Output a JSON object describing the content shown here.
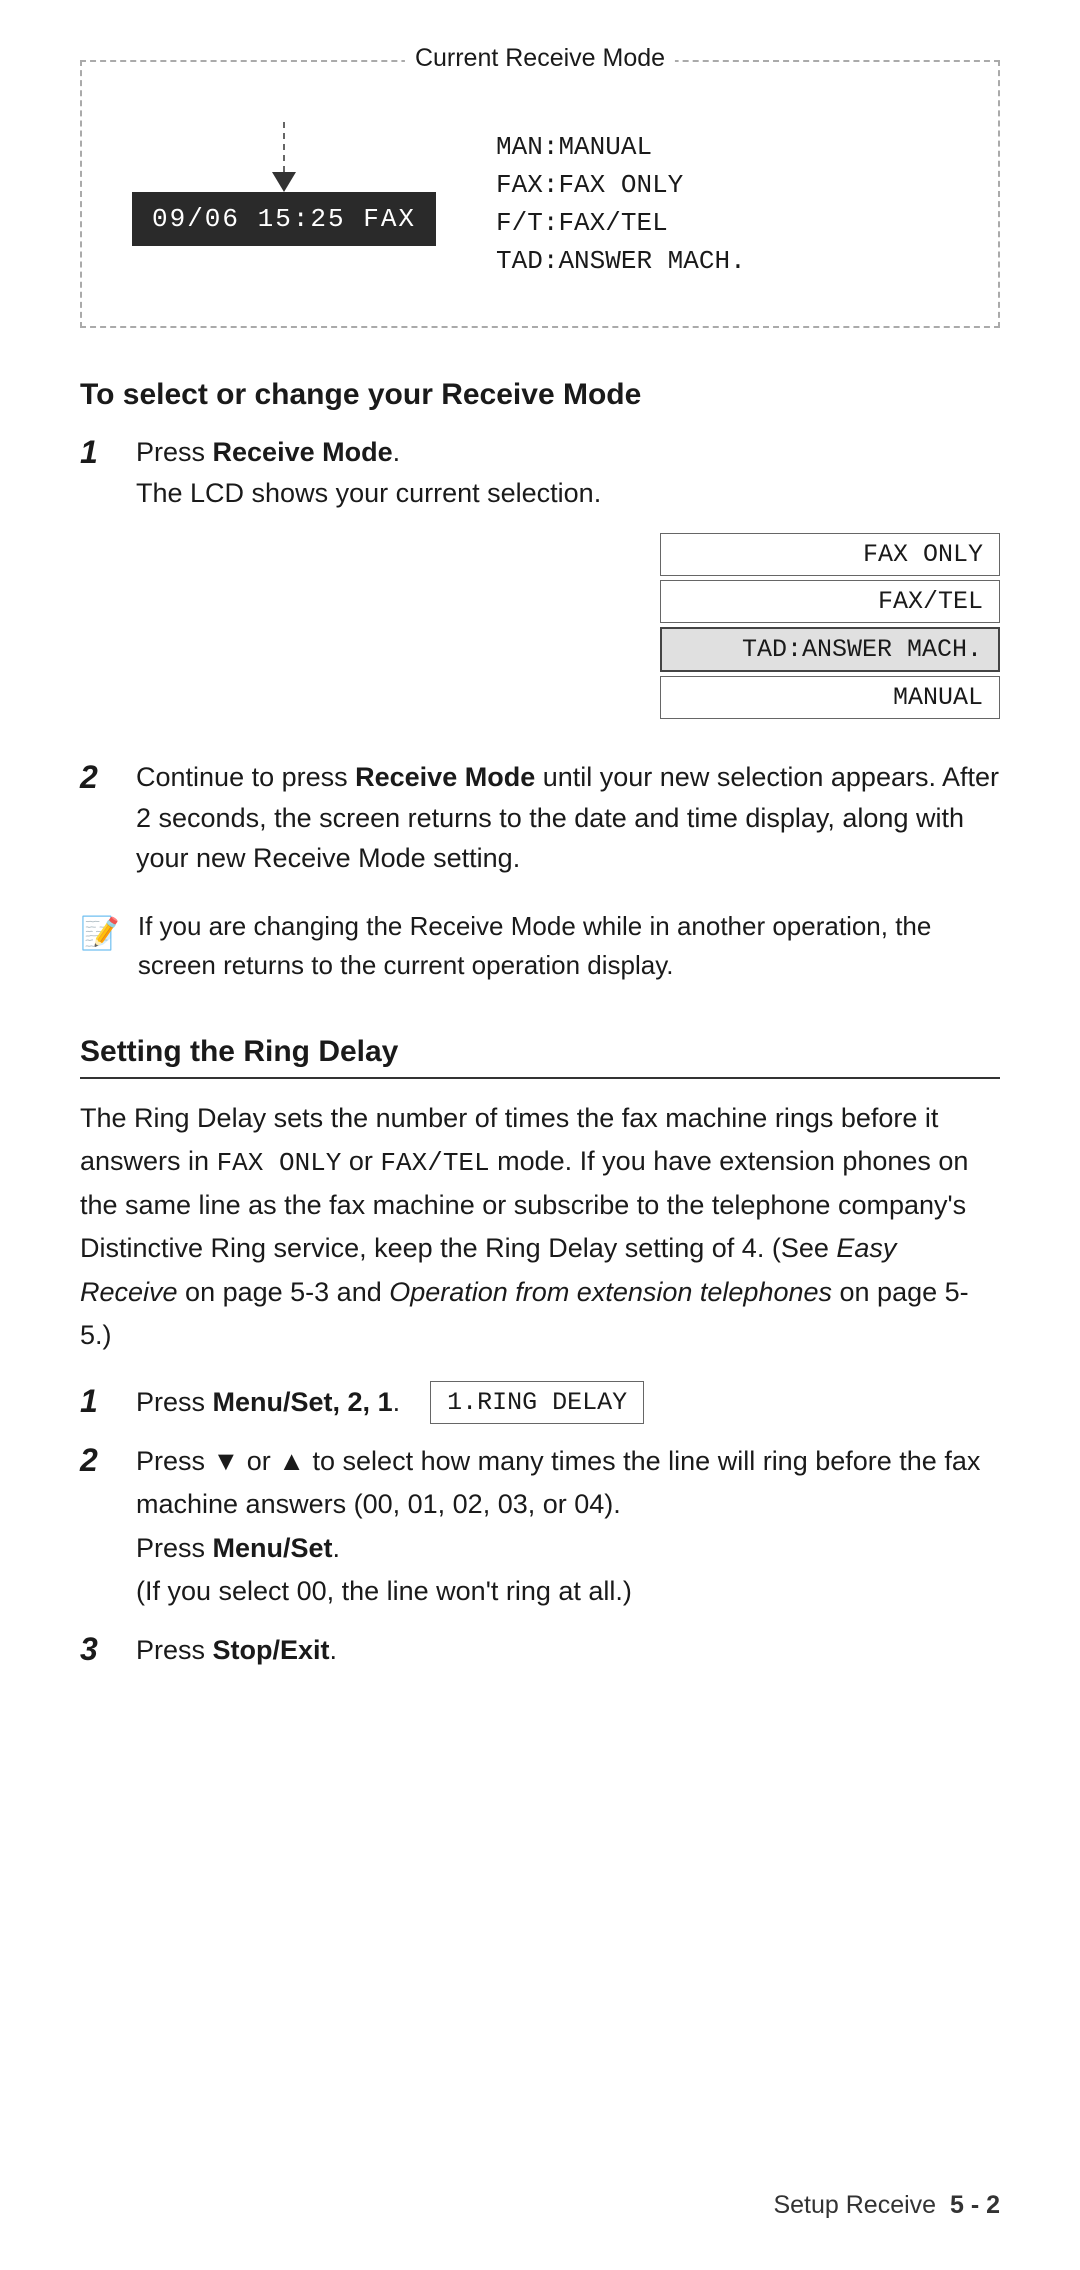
{
  "diagram": {
    "current_receive_label": "Current Receive Mode",
    "lcd_display": "09/06 15:25   FAX",
    "modes": [
      "MAN:MANUAL",
      "FAX:FAX ONLY",
      "F/T:FAX/TEL",
      "TAD:ANSWER MACH."
    ]
  },
  "section1": {
    "heading": "To select or change your Receive Mode",
    "step1_number": "1",
    "step1_bold": "Receive Mode",
    "step1_prefix": "Press ",
    "step1_suffix": ".",
    "step1_sub": "The LCD shows your current selection.",
    "lcd_options": [
      {
        "label": "FAX ONLY",
        "highlighted": false
      },
      {
        "label": "FAX/TEL",
        "highlighted": false
      },
      {
        "label": "TAD:ANSWER MACH.",
        "highlighted": true
      },
      {
        "label": "MANUAL",
        "highlighted": false
      }
    ],
    "step2_number": "2",
    "step2_bold1": "Receive",
    "step2_bold2": "Mode",
    "step2_text": "Continue to press ",
    "step2_text2": " until your new selection appears. After 2 seconds, the screen returns to the date and time display, along with your new Receive Mode setting.",
    "note_text": "If you are changing the Receive Mode while in another operation, the screen returns to the current operation display."
  },
  "section2": {
    "heading": "Setting the Ring Delay",
    "body": "The Ring Delay sets the number of times the fax machine rings before it answers in FAX ONLY or FAX/TEL mode. If you have extension phones on the same line as the fax machine or subscribe to the telephone company's Distinctive Ring service, keep the Ring Delay setting of 4. (See Easy Receive on page 5-3 and Operation from extension telephones on page 5-5.)",
    "step1_number": "1",
    "step1_text": "Press ",
    "step1_bold": "Menu/Set, 2, 1",
    "step1_text2": ".",
    "lcd_ring_delay": "1.RING DELAY",
    "step2_number": "2",
    "step2_text1": "Press ",
    "step2_down_arrow": "▼",
    "step2_or": " or ",
    "step2_up_arrow": "▲",
    "step2_text2": " to select how many times the line will ring before the fax machine answers (00, 01, 02, 03, or 04).",
    "step2_sub_bold": "Menu/Set",
    "step2_sub_prefix": "Press ",
    "step2_sub_suffix": ".",
    "step2_sub2": "(If you select 00, the line won't ring at all.)",
    "step3_number": "3",
    "step3_text": "Press ",
    "step3_bold": "Stop/Exit",
    "step3_suffix": "."
  },
  "footer": {
    "label": "Setup Receive",
    "page": "5 - 2"
  }
}
